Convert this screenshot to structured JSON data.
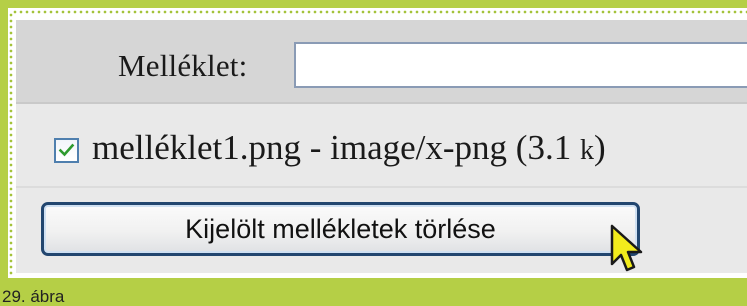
{
  "form": {
    "attachment_label": "Melléklet:",
    "attachment_input_value": ""
  },
  "attachments": [
    {
      "checked": true,
      "filename": "melléklet1.png",
      "separator": " - ",
      "mime_type": "image/x-png",
      "size_open": " (3.1 ",
      "size_unit": "k",
      "size_close": ")"
    }
  ],
  "actions": {
    "delete_selected_label": "Kijelölt mellékletek törlése"
  },
  "caption": "29. ábra",
  "colors": {
    "frame_green": "#b5cf46",
    "gray_panel": "#e9e9e9",
    "label_row": "#d6d6d6",
    "checkbox_mark": "#2e9a2e",
    "button_border": "#22466f",
    "cursor_fill": "#f2ec1c"
  },
  "icons": {
    "checkbox": "checkmark-icon",
    "cursor": "arrow-cursor-icon"
  }
}
